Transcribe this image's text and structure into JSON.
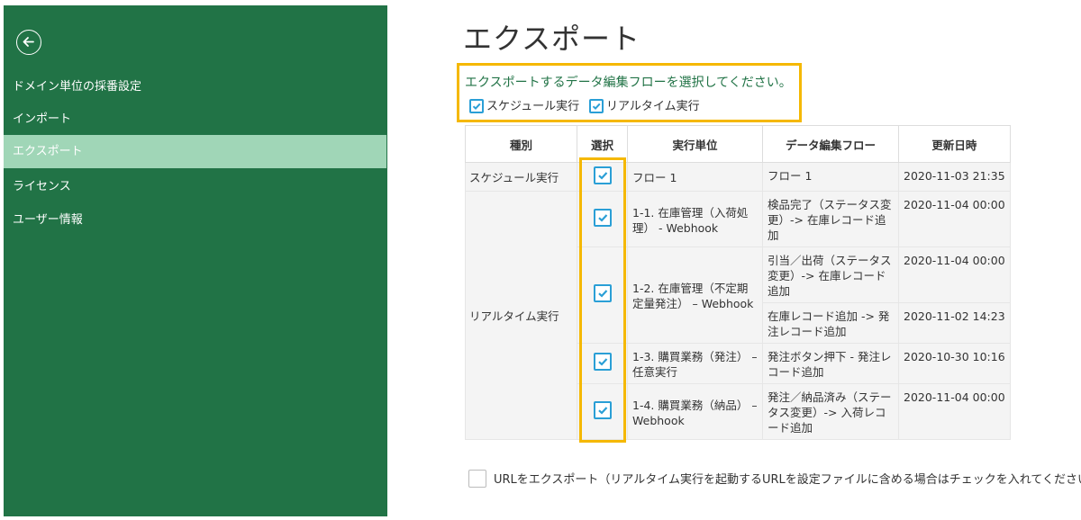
{
  "sidebar": {
    "items": [
      {
        "label": "ドメイン単位の採番設定"
      },
      {
        "label": "インポート"
      },
      {
        "label": "エクスポート"
      },
      {
        "label": "ライセンス"
      },
      {
        "label": "ユーザー情報"
      }
    ],
    "active_index": 2
  },
  "main": {
    "title": "エクスポート",
    "instruction": "エクスポートするデータ編集フローを選択してください。",
    "filters": [
      {
        "label": "スケジュール実行",
        "checked": true
      },
      {
        "label": "リアルタイム実行",
        "checked": true
      }
    ],
    "table": {
      "headers": [
        "種別",
        "選択",
        "実行単位",
        "データ編集フロー",
        "更新日時"
      ],
      "groups": [
        {
          "kind": "スケジュール実行"
        },
        {
          "kind": "リアルタイム実行"
        }
      ],
      "rows": [
        {
          "unit": "フロー 1",
          "flow": "フロー 1",
          "date": "2020-11-03 21:35",
          "checked": true
        },
        {
          "unit": "1-1. 在庫管理（入荷処理） - Webhook",
          "flow": "検品完了（ステータス変更）-> 在庫レコード追加",
          "date": "2020-11-04 00:00",
          "checked": true
        },
        {
          "unit": "1-2. 在庫管理（不定期定量発注） – Webhook",
          "flow": "引当／出荷（ステータス変更）-> 在庫レコード追加",
          "date": "2020-11-04 00:00",
          "checked": true
        },
        {
          "flow": "在庫レコード追加 -> 発注レコード追加",
          "date": "2020-11-02 14:23"
        },
        {
          "unit": "1-3. 購買業務（発注） – 任意実行",
          "flow": "発注ボタン押下 - 発注レコード追加",
          "date": "2020-10-30 10:16",
          "checked": true
        },
        {
          "unit": "1-4.  購買業務（納品） – Webhook",
          "flow": "発注／納品済み（ステータス変更）-> 入荷レコード追加",
          "date": "2020-11-04 00:00",
          "checked": true
        }
      ]
    },
    "url_export": {
      "label": "URLをエクスポート（リアルタイム実行を起動するURLを設定ファイルに含める場合はチェックを入れてください）",
      "checked": false
    }
  },
  "colors": {
    "sidebar_bg": "#217346",
    "sidebar_active": "#a0d6b7",
    "highlight": "#f5b800",
    "checkbox": "#2a9fd6",
    "instruction_text": "#217346"
  },
  "icons": [
    "back-arrow-icon",
    "checkmark-icon"
  ]
}
